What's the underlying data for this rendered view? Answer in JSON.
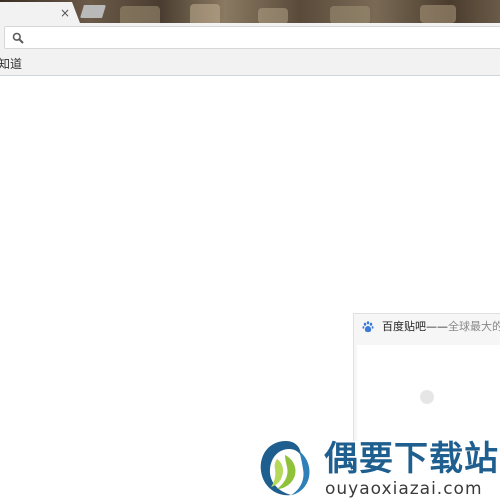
{
  "tabs": {
    "active_close_glyph": "×",
    "new_tab_icon": "new-tab-button"
  },
  "toolbar": {
    "address_value": "",
    "address_placeholder": "",
    "search_icon": "search-icon"
  },
  "bookmarks": {
    "items": [
      {
        "label": "知道"
      }
    ]
  },
  "tab_preview": {
    "icon": "baidu-paw-icon",
    "title_main": "百度贴吧——",
    "title_rest": "全球最大的"
  },
  "watermark": {
    "brand_name": "偶要下载站",
    "domain": "ouyaoxiazai.com",
    "brand_color": "#1f5f8f"
  }
}
